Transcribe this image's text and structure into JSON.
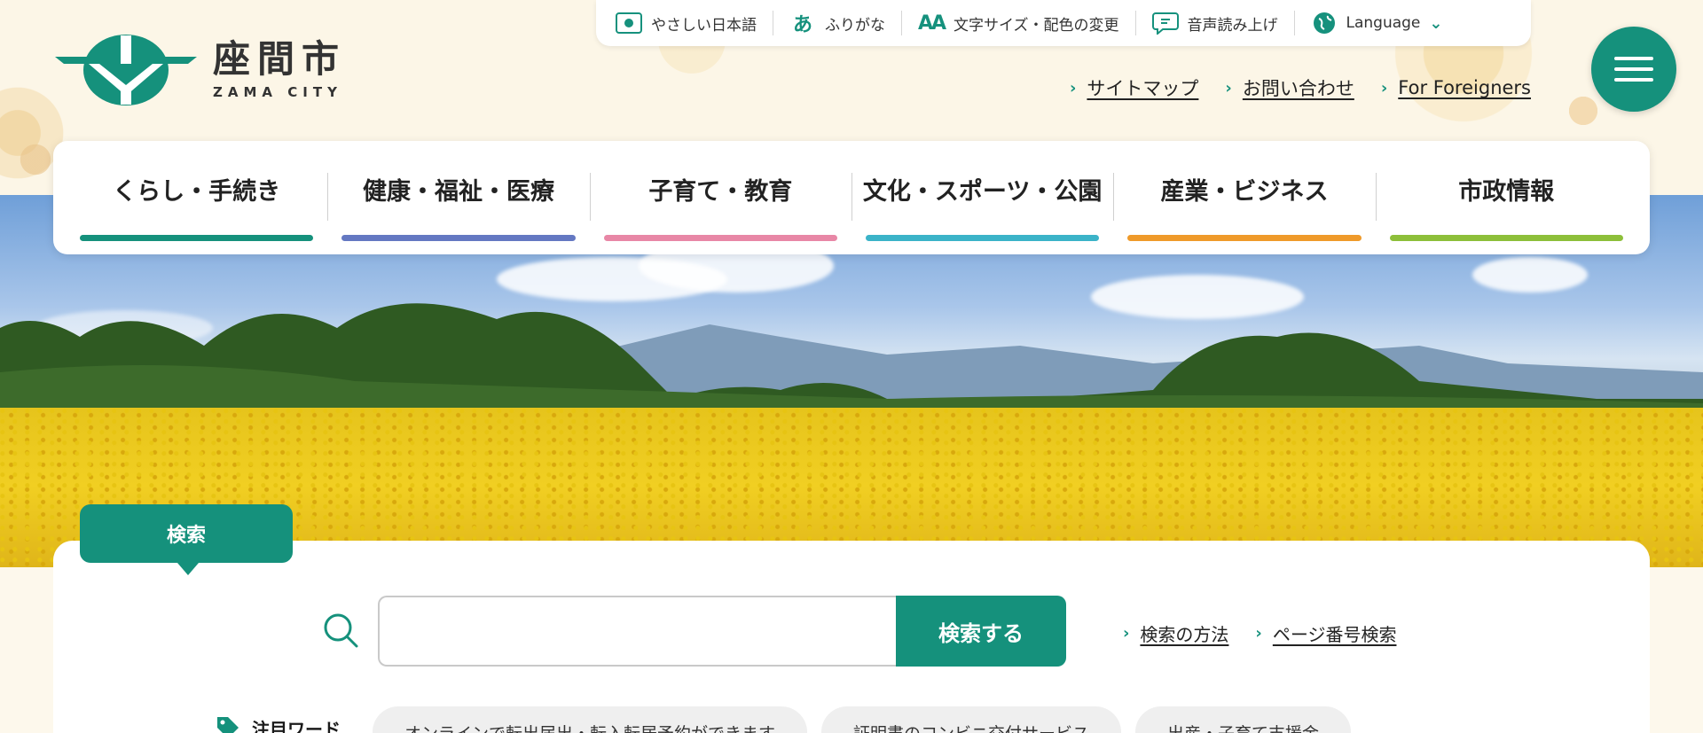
{
  "site": {
    "logo_jp": "座間市",
    "logo_en": "ZAMA CITY"
  },
  "utility": [
    {
      "label": "やさしい日本語",
      "icon": "easy-japanese-icon"
    },
    {
      "label": "ふりがな",
      "icon": "furigana-icon"
    },
    {
      "label": "文字サイズ・配色の変更",
      "icon": "text-size-icon"
    },
    {
      "label": "音声読み上げ",
      "icon": "speech-icon"
    },
    {
      "label": "Language",
      "icon": "globe-icon"
    }
  ],
  "sublinks": [
    "サイトマップ",
    "お問い合わせ",
    "For Foreigners"
  ],
  "nav": [
    {
      "label": "くらし・手続き",
      "color": "#15917c"
    },
    {
      "label": "健康・福祉・医療",
      "color": "#6478c2"
    },
    {
      "label": "子育て・教育",
      "color": "#e887a6"
    },
    {
      "label": "文化・スポーツ・公園",
      "color": "#3bb3c8"
    },
    {
      "label": "産業・ビジネス",
      "color": "#ef9a2a"
    },
    {
      "label": "市政情報",
      "color": "#8dbf3a"
    }
  ],
  "search": {
    "tab_label": "検索",
    "input_value": "",
    "placeholder": "",
    "button_label": "検索する",
    "links": [
      "検索の方法",
      "ページ番号検索"
    ]
  },
  "keywords": {
    "label": "注目ワード",
    "items": [
      "オンラインで転出届出・転入転居予約ができます",
      "証明書のコンビニ交付サービス",
      "出産・子育て支援金"
    ]
  },
  "colors": {
    "brand": "#15917c"
  }
}
